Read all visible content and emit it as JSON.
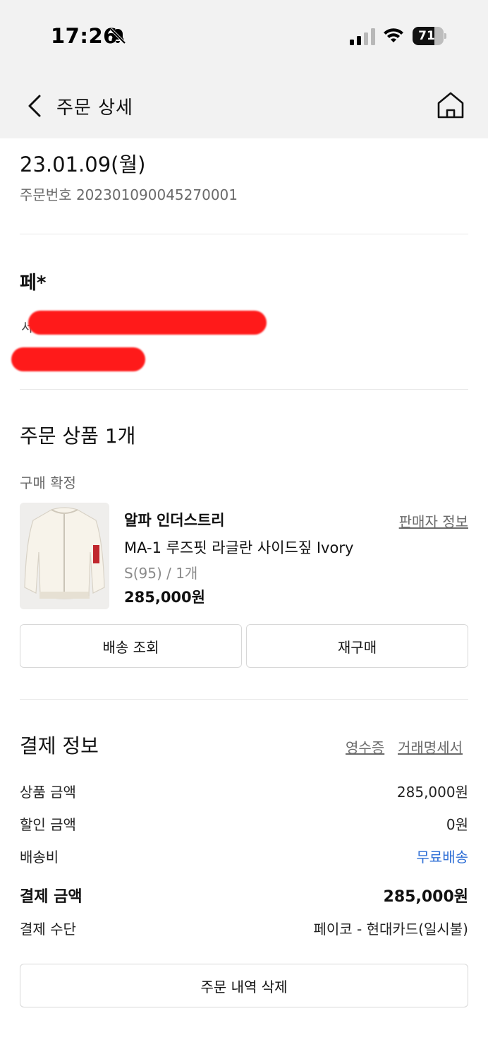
{
  "status_bar": {
    "time": "17:26",
    "battery": "71",
    "battery_level": 0.71
  },
  "nav": {
    "title": "주문 상세"
  },
  "order": {
    "date": "23.01.09(월)",
    "number": "주문번호 202301090045270001"
  },
  "recipient": {
    "name": "페*",
    "address_visible_char": "서"
  },
  "products_section": {
    "title": "주문 상품 1개",
    "status": "구매 확정",
    "item": {
      "brand": "알파 인더스트리",
      "seller_link": "판매자 정보",
      "name": "MA-1 루즈핏 라글란 사이드짚 Ivory",
      "option": "S(95) / 1개",
      "price": "285,000원"
    },
    "buttons": {
      "delivery": "배송 조회",
      "rebuy": "재구매"
    }
  },
  "payment": {
    "title": "결제 정보",
    "receipt_link": "영수증",
    "statement_link": "거래명세서",
    "rows": [
      {
        "label": "상품 금액",
        "value": "285,000원"
      },
      {
        "label": "할인 금액",
        "value": "0원"
      },
      {
        "label": "배송비",
        "value": "무료배송"
      },
      {
        "label": "결제 금액",
        "value": "285,000원"
      },
      {
        "label": "결제 수단",
        "value": "페이코 - 현대카드(일시불)"
      }
    ],
    "delete_button": "주문 내역 삭제"
  }
}
